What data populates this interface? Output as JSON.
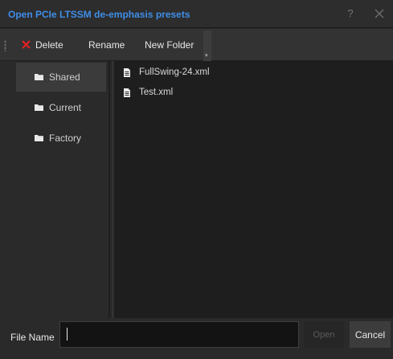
{
  "window": {
    "title": "Open PCIe LTSSM de-emphasis presets",
    "help_label": "?",
    "accent_color": "#3f8ee8"
  },
  "toolbar": {
    "delete_label": "Delete",
    "rename_label": "Rename",
    "new_folder_label": "New Folder",
    "delete_icon_color": "#e02020"
  },
  "sidebar": {
    "items": [
      {
        "label": "Shared",
        "icon": "folder-icon",
        "selected": true
      },
      {
        "label": "Current",
        "icon": "folder-icon",
        "selected": false
      },
      {
        "label": "Factory",
        "icon": "folder-icon",
        "selected": false
      }
    ]
  },
  "files": {
    "items": [
      {
        "name": "FullSwing-24.xml",
        "icon": "file-icon"
      },
      {
        "name": "Test.xml",
        "icon": "file-icon"
      }
    ]
  },
  "footer": {
    "file_name_label": "File Name",
    "file_name_value": "",
    "open_label": "Open",
    "cancel_label": "Cancel"
  }
}
